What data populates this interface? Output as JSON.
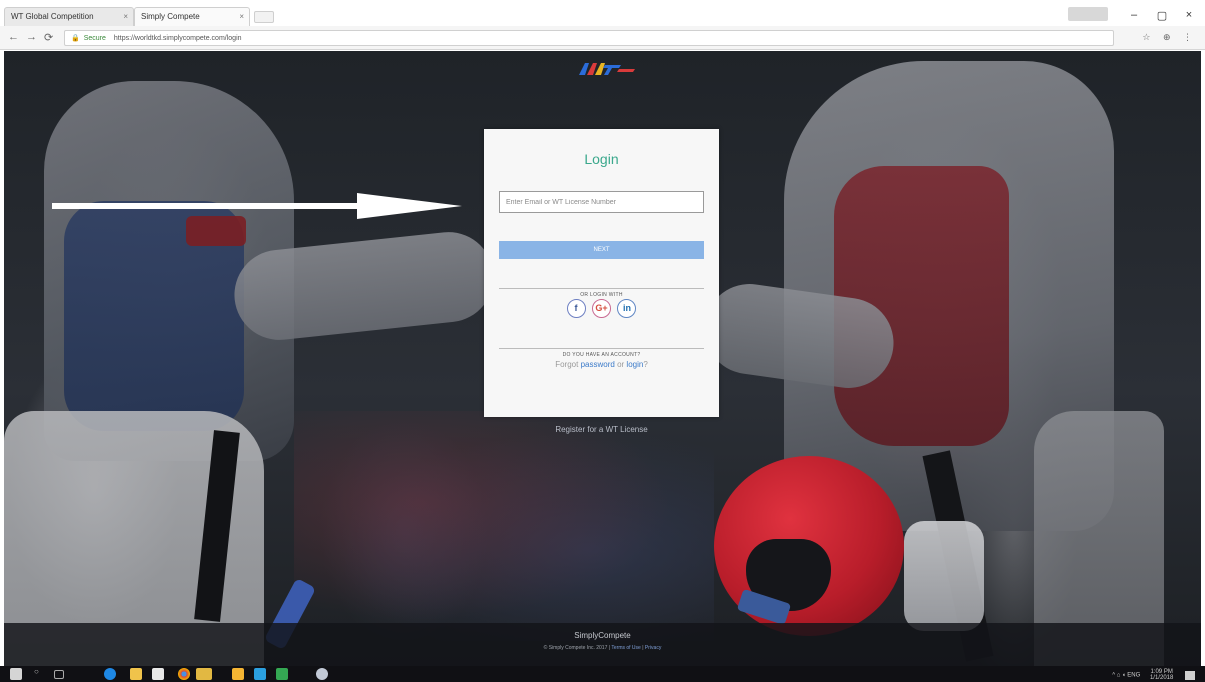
{
  "browser": {
    "tabs": [
      {
        "label": "WT Global Competition"
      },
      {
        "label": "Simply Compete"
      }
    ],
    "address": {
      "secure_label": "Secure",
      "url": "https://worldtkd.simplycompete.com/login"
    },
    "user_chip": "",
    "window_controls": {
      "minimize": "–",
      "maximize": "▢",
      "close": "×"
    },
    "nav": {
      "back": "←",
      "forward": "→",
      "reload": "⟳"
    }
  },
  "page": {
    "logo_text": "WT",
    "login": {
      "title": "Login",
      "email_placeholder": "Enter Email or WT License Number",
      "next_button": "Next",
      "social_divider": "or login with",
      "socials": [
        {
          "name": "facebook",
          "glyph": "f",
          "color": "#3b5998"
        },
        {
          "name": "google-plus",
          "glyph": "G+",
          "color": "#d44c3d"
        },
        {
          "name": "linkedin",
          "glyph": "in",
          "color": "#1f6fb0"
        }
      ],
      "account_divider": "Do you have an account?",
      "forgot_prefix": "Forgot",
      "forgot_link": "password",
      "or_text": "or",
      "login_link": "login",
      "forgot_suffix": "?"
    },
    "register_link": "Register for a WT License",
    "footer": {
      "brand": "SimplyCompete",
      "copyright": "© Simply Compete Inc. 2017 |",
      "terms_link": "Terms of Use",
      "separator": "|",
      "privacy_link": "Privacy"
    },
    "accent_color": "#3aa88c",
    "button_color": "#8ab4e6"
  },
  "taskbar": {
    "tray_text": "^ ⌂ ◖ ENG",
    "time": "1:09 PM",
    "date": "1/1/2018"
  }
}
